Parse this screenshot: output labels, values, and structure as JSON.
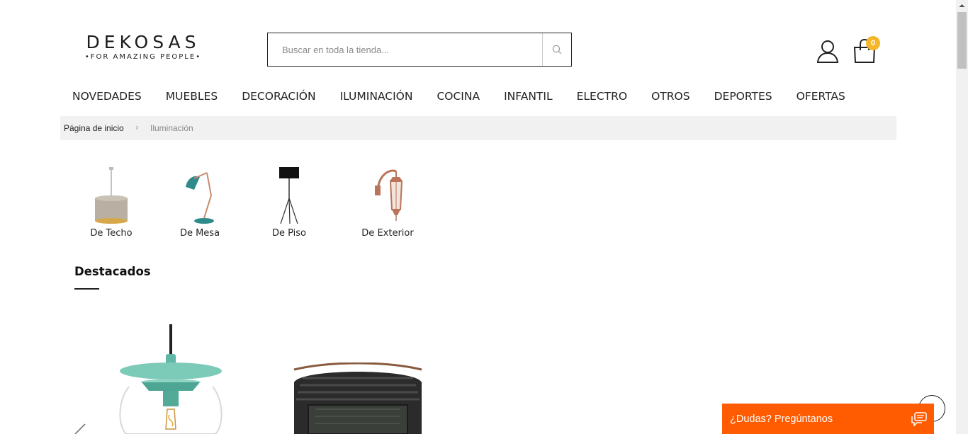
{
  "brand": {
    "name": "DEKOSAS",
    "tagline": "•FOR AMAZING PEOPLE•"
  },
  "search": {
    "placeholder": "Buscar en toda la tienda..."
  },
  "header": {
    "cart_count": "0"
  },
  "nav": {
    "items": [
      "NOVEDADES",
      "MUEBLES",
      "DECORACIÓN",
      "ILUMINACIÓN",
      "COCINA",
      "INFANTIL",
      "ELECTRO",
      "OTROS",
      "DEPORTES",
      "OFERTAS"
    ]
  },
  "breadcrumb": {
    "home": "Página de inicio",
    "separator": "›",
    "current": "Iluminación"
  },
  "categories": [
    {
      "label": "De Techo",
      "icon": "pendant-lamp-icon"
    },
    {
      "label": "De Mesa",
      "icon": "desk-lamp-icon"
    },
    {
      "label": "De Piso",
      "icon": "floor-lamp-icon"
    },
    {
      "label": "De Exterior",
      "icon": "wall-lantern-icon"
    }
  ],
  "featured": {
    "title": "Destacados"
  },
  "chat": {
    "label": "¿Dudas? Pregúntanos"
  },
  "colors": {
    "accent": "#ff5b00",
    "badge": "#f5b629",
    "breadcrumb_bg": "#f1f1f1"
  }
}
